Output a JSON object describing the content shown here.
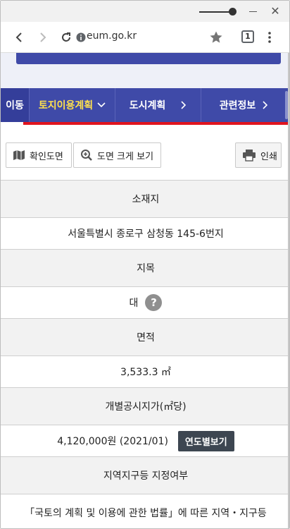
{
  "browser": {
    "url": "eum.go.kr",
    "tab_count": "1"
  },
  "nav": {
    "move_label": "이동",
    "land_use_label": "토지이용계획",
    "city_plan_label": "도시계획",
    "related_info_label": "관련정보",
    "accent_color": "#ffe14d",
    "bar_color": "#3f4aa8",
    "highlight_color": "#e0141e"
  },
  "actions": {
    "confirm_map_label": "확인도면",
    "enlarge_map_label": "도면 크게 보기",
    "print_label": "인쇄"
  },
  "info": {
    "location_header": "소재지",
    "location_value": "서울특별시 종로구 삼청동 145-6번지",
    "land_category_header": "지목",
    "land_category_value": "대",
    "help_symbol": "?",
    "area_header": "면적",
    "area_value": "3,533.3 ㎡",
    "price_header": "개별공시지가(㎡당)",
    "price_value": "4,120,000원 (2021/01)",
    "yearly_button_label": "연도별보기",
    "zoning_header": "지역지구등 지정여부",
    "zoning_value": "「국토의 계획 및 이용에 관한 법률」에 따른 지역・지구등"
  }
}
